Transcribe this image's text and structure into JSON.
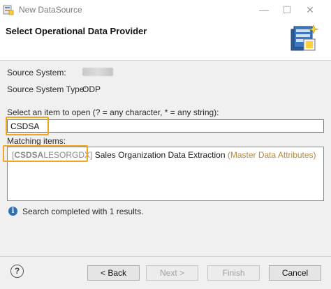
{
  "window": {
    "title": "New DataSource",
    "minimize_glyph": "—",
    "maximize_glyph": "☐",
    "close_glyph": "✕"
  },
  "header": {
    "heading": "Select Operational Data Provider",
    "icon": "datasource-wizard-icon"
  },
  "source": {
    "system_label": "Source System:",
    "system_value": "",
    "type_label": "Source System Type:",
    "type_value": "ODP"
  },
  "search": {
    "label": "Select an item to open (? = any character, * = any string):",
    "value": "CSDSA",
    "highlight_color": "#f0a81e"
  },
  "matching": {
    "label": "Matching items:",
    "items": [
      {
        "id_prefix": "[",
        "id_match": "CSDSA",
        "id_rest": "LESORGDX]",
        "description": " Sales Organization Data Extraction",
        "type": " (Master Data Attributes)"
      }
    ]
  },
  "status": {
    "icon": "info-icon",
    "glyph": "i",
    "text": "Search completed with 1 results."
  },
  "footer": {
    "help_glyph": "?",
    "back_label": "< Back",
    "next_label": "Next >",
    "finish_label": "Finish",
    "cancel_label": "Cancel"
  },
  "colors": {
    "accent_highlight": "#f0a81e",
    "info_blue": "#2f6fb5",
    "type_text": "#b58a3e"
  }
}
